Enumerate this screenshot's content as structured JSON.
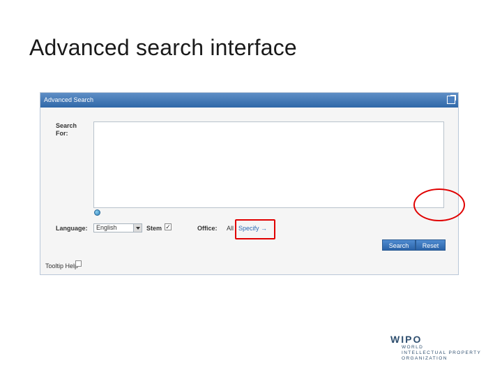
{
  "slide": {
    "title": "Advanced search interface"
  },
  "panel": {
    "header_title": "Advanced Search",
    "search_for_label": "Search For:",
    "search_value": "",
    "language_label": "Language:",
    "language_selected": "English",
    "stem_label": "Stem",
    "stem_checked": true,
    "stem_mark": "✓",
    "office_label": "Office:",
    "office_value": "All",
    "specify_label": "Specify",
    "specify_arrow": "→",
    "search_button": "Search",
    "reset_button": "Reset",
    "tooltip_label": "Tooltip Help",
    "tooltip_checked": false
  },
  "annotations": {
    "highlight_color": "#e00000"
  },
  "logo": {
    "mark": "WIPO",
    "lines": [
      "WORLD",
      "INTELLECTUAL PROPERTY",
      "ORGANIZATION"
    ]
  },
  "colors": {
    "header_blue": "#2f67a8",
    "button_blue": "#2a63a8",
    "link_blue": "#2d6cb5"
  }
}
